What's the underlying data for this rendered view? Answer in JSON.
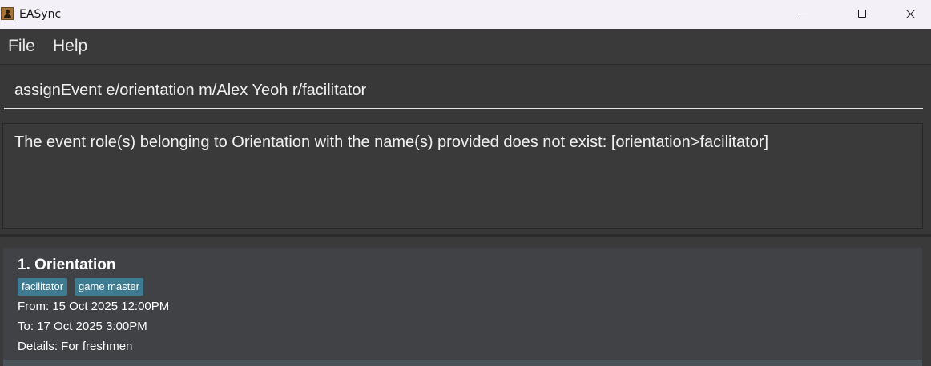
{
  "window": {
    "title": "EASync",
    "icon": "app-icon"
  },
  "menu": {
    "file_label": "File",
    "help_label": "Help"
  },
  "command": {
    "value": "assignEvent e/orientation m/Alex Yeoh r/facilitator"
  },
  "result": {
    "message": "The event role(s) belonging to Orientation with the name(s) provided does not exist: [orientation>facilitator]"
  },
  "events": [
    {
      "title": "1. Orientation",
      "roles": [
        "facilitator",
        "game master"
      ],
      "from": "From: 15 Oct 2025 12:00PM",
      "to": "To: 17 Oct 2025 3:00PM",
      "details": "Details: For freshmen"
    }
  ],
  "colors": {
    "titlebar": "#f3f0f7",
    "background": "#383838",
    "card": "#404245",
    "tag": "#3e7b91"
  }
}
